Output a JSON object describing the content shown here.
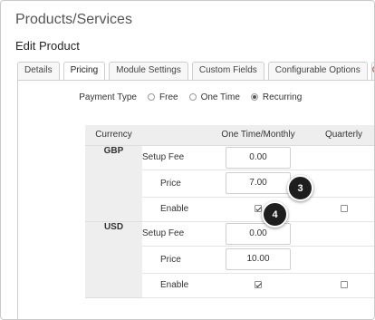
{
  "page": {
    "title": "Products/Services",
    "section": "Edit Product"
  },
  "tabs": [
    {
      "label": "Details",
      "active": false
    },
    {
      "label": "Pricing",
      "active": true
    },
    {
      "label": "Module Settings",
      "active": false
    },
    {
      "label": "Custom Fields",
      "active": false
    },
    {
      "label": "Configurable Options",
      "active": false
    },
    {
      "label": "O",
      "active": false
    }
  ],
  "payment_type": {
    "label": "Payment Type",
    "options": [
      {
        "label": "Free",
        "checked": false
      },
      {
        "label": "One Time",
        "checked": false
      },
      {
        "label": "Recurring",
        "checked": true
      }
    ]
  },
  "pricing_table": {
    "headers": {
      "currency": "Currency",
      "one_time": "One Time/Monthly",
      "quarterly": "Quarterly"
    },
    "currencies": [
      {
        "code": "GBP",
        "setup_fee_label": "Setup Fee",
        "setup_fee": "0.00",
        "price_label": "Price",
        "price": "7.00",
        "enable_label": "Enable",
        "enable_one_time": true,
        "enable_quarterly": false
      },
      {
        "code": "USD",
        "setup_fee_label": "Setup Fee",
        "setup_fee": "0.00",
        "price_label": "Price",
        "price": "10.00",
        "enable_label": "Enable",
        "enable_one_time": true,
        "enable_quarterly": false
      }
    ]
  },
  "annotations": {
    "step_price": "3",
    "step_enable": "4"
  }
}
